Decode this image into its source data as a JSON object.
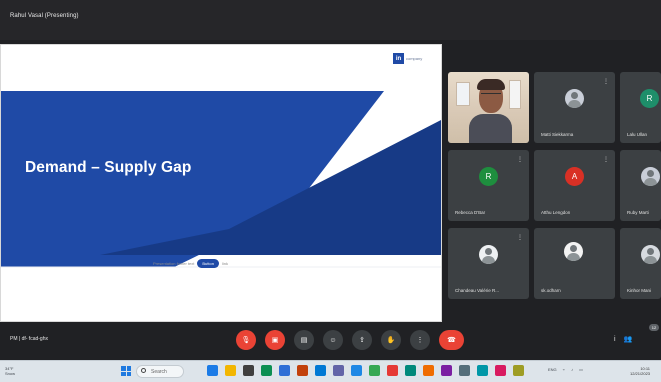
{
  "meeting": {
    "presenting_label": "Rahul Vasal (Presenting)",
    "bottom_info": "PM | df- fcad-ghx"
  },
  "slide": {
    "logo_mark": "in",
    "logo_text": "company",
    "title": "Demand – Supply Gap",
    "footer_text": "Presentation footer text",
    "footer_pill": "Button",
    "footer_suffix": "link"
  },
  "participants": [
    {
      "name": "",
      "initial": "",
      "color": "",
      "type": "video"
    },
    {
      "name": "Matti Siekkarma",
      "initial": "",
      "color": "#8ea2b8",
      "type": "photo"
    },
    {
      "name": "Lalu Ullan",
      "initial": "R",
      "color": "#1e8e6a",
      "type": "initial"
    },
    {
      "name": "Rebecca D'Bar",
      "initial": "R",
      "color": "#1e8e3e",
      "type": "initial"
    },
    {
      "name": "Atthu Lengdon",
      "initial": "A",
      "color": "#d93025",
      "type": "initial"
    },
    {
      "name": "Ruby Marti",
      "initial": "",
      "color": "#8d8f91",
      "type": "photo"
    },
    {
      "name": "Chandeau Valérie R...",
      "initial": "",
      "color": "#c1c7cf",
      "type": "photo"
    },
    {
      "name": "sk.odharn",
      "initial": "",
      "color": "#d9dcdf",
      "type": "photo"
    },
    {
      "name": "Kinhor Mani",
      "initial": "",
      "color": "#bbb",
      "type": "photo"
    }
  ],
  "controls": {
    "mic": "mic",
    "camera": "camera",
    "captions": "captions",
    "reactions": "emoji",
    "present": "present",
    "raise_hand": "hand",
    "more": "more",
    "end_call": "end call",
    "info": "i",
    "people": "people",
    "people_count": "12"
  },
  "taskbar": {
    "left_line1": "34°F",
    "left_line2": "Snow",
    "search_label": "Search",
    "tray_text": "ENG",
    "clock_time": "10:11",
    "clock_date": "12/21/2023"
  }
}
